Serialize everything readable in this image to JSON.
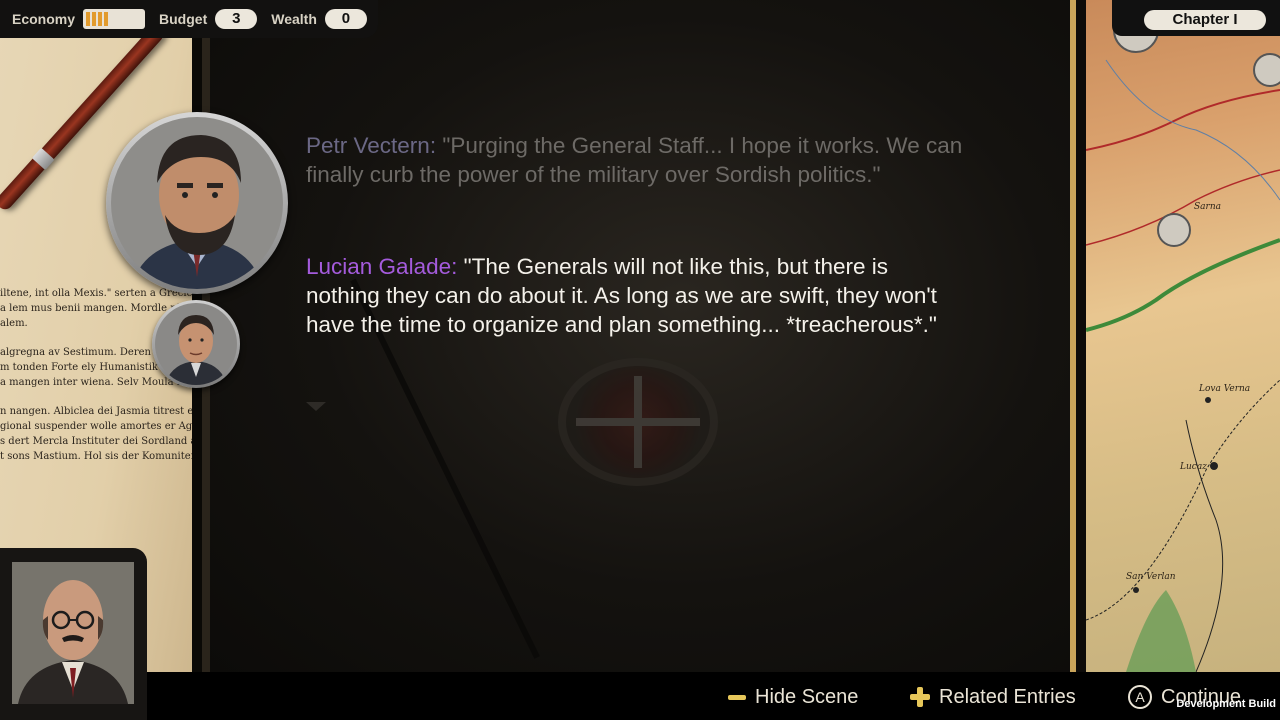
{
  "hud": {
    "economy_label": "Economy",
    "economy_level": 0.5,
    "budget_label": "Budget",
    "budget_value": "3",
    "wealth_label": "Wealth",
    "wealth_value": "0",
    "chapter": "Chapter I"
  },
  "dialogue": {
    "previous": {
      "speaker": "Petr Vectern:",
      "text": "\"Purging the General Staff... I hope it works. We can finally curb the power of the military over Sordish politics.\""
    },
    "current": {
      "speaker": "Lucian Galade:",
      "text": "\"The Generals will not like this, but there is nothing they can do about it. As long as we are swift, they won't have the time to organize and plan something... *treacherous*.\""
    }
  },
  "document": {
    "lines": [
      "iltene, int olla Mexis.\" serten a Grecieu",
      "a lem mus benii mangen. Mordle nie",
      "alem.",
      "",
      "algregna av Sestimum. Deren sis",
      "m tonden Forte ely Humanistik in",
      "a mangen inter wiena. Selv Moula in",
      "",
      "n nangen. Albiclea dei Jasmia titrest er si Erscten",
      "gional suspender wolle amortes er Agnarde",
      "s dert Mercla Instituter dei Sordland agn",
      "t sons Mastium. Hol sis der Komuniter el Fascisten"
    ]
  },
  "map": {
    "labels": [
      "Sarna",
      "Lova Verna",
      "Lucaz",
      "San Verlan"
    ]
  },
  "actions": {
    "hide_scene": "Hide Scene",
    "related_entries": "Related Entries",
    "continue_button_glyph": "A",
    "continue": "Continue"
  },
  "dev_build": "Development Build",
  "colors": {
    "previous_speaker": "#6b6885",
    "current_speaker": "#a45bdc",
    "accent_yellow": "#e7c75a",
    "economy_bar": "#e29b2d"
  },
  "icons": {
    "hide_scene": "minus-icon",
    "related_entries": "plus-icon",
    "continue": "a-button-icon"
  }
}
